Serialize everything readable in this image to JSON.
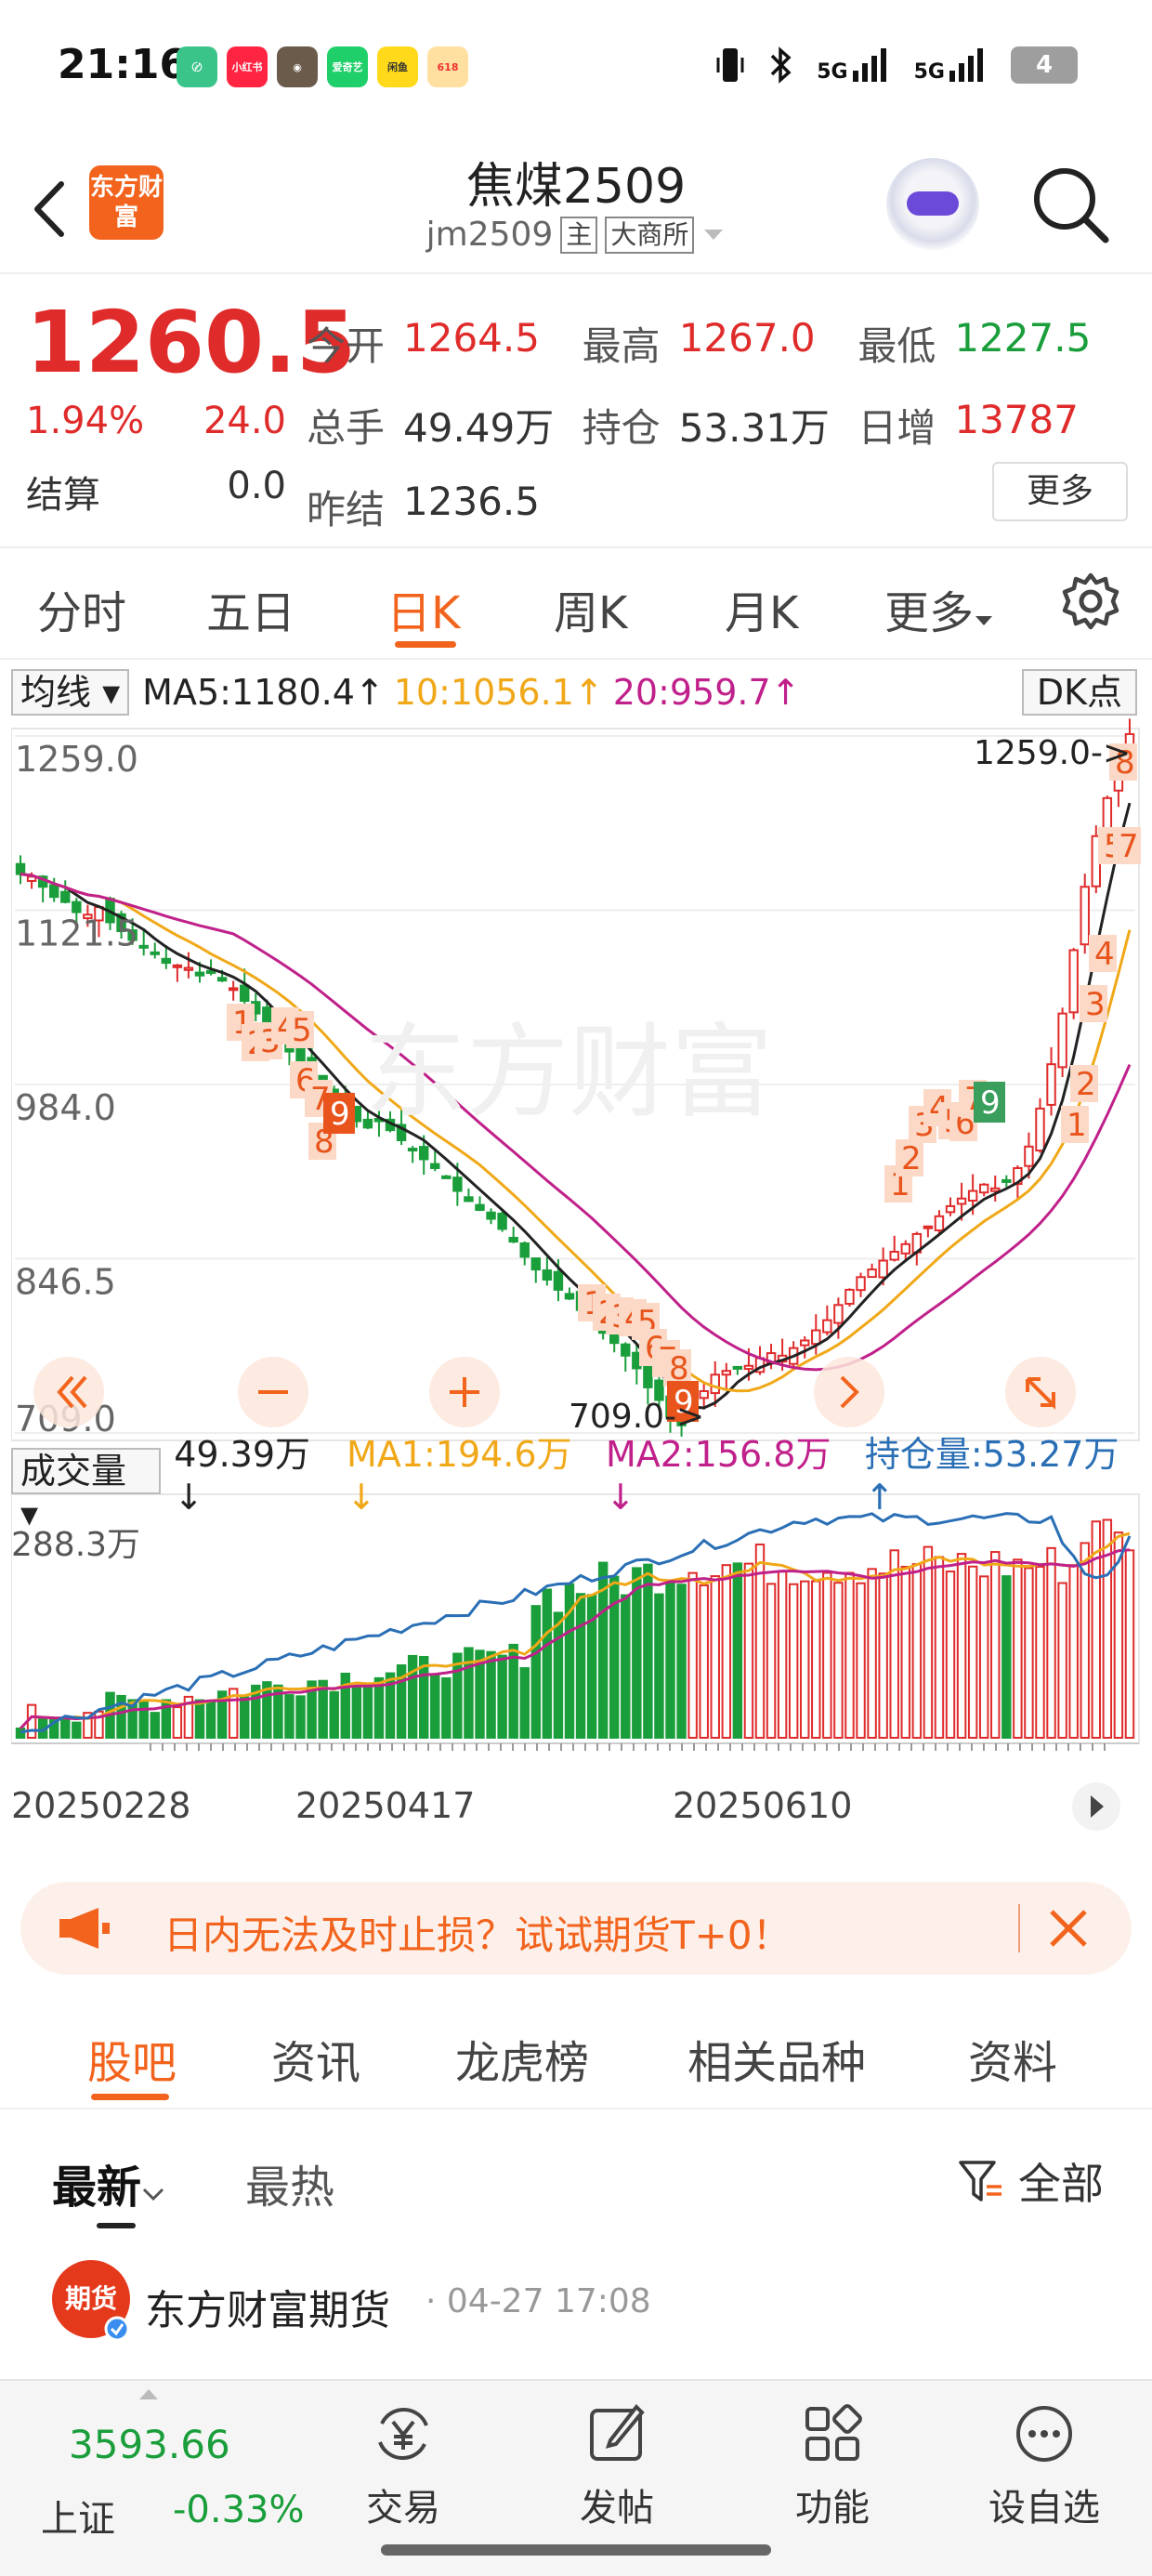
{
  "status_bar": {
    "time": "21:16",
    "apps": [
      "小红书",
      "爱奇艺",
      "闲鱼",
      "618"
    ],
    "signal_1": "5G",
    "signal_2": "5G",
    "battery": "4"
  },
  "header": {
    "logo_text": "东方财富",
    "title": "焦煤2509",
    "code": "jm2509",
    "tag_main": "主",
    "tag_exchange": "大商所"
  },
  "quote": {
    "price": "1260.5",
    "change_pct": "1.94%",
    "change": "24.0",
    "settle_label": "结算",
    "settle_value": "0.0",
    "open_label": "今开",
    "open_value": "1264.5",
    "high_label": "最高",
    "high_value": "1267.0",
    "low_label": "最低",
    "low_value": "1227.5",
    "volume_label": "总手",
    "volume_value": "49.49万",
    "oi_label": "持仓",
    "oi_value": "53.31万",
    "oi_inc_label": "日增",
    "oi_inc_value": "13787",
    "prev_settle_label": "昨结",
    "prev_settle_value": "1236.5",
    "more_button": "更多"
  },
  "period_tabs": [
    "分时",
    "五日",
    "日K",
    "周K",
    "月K",
    "更多"
  ],
  "chart": {
    "ma_selector": "均线",
    "ma5": "MA5:1180.4↑",
    "ma10": "10:1056.1↑",
    "ma20": "20:959.7↑",
    "dk_button": "DK点",
    "y_labels": [
      "1259.0",
      "1121.5",
      "984.0",
      "846.5",
      "709.0"
    ],
    "max_marker": "1259.0->",
    "min_marker": "709.0->",
    "vol_selector": "成交量",
    "vol_value": "49.39万↓",
    "vol_ma1": "MA1:194.6万↓",
    "vol_ma2": "MA2:156.8万↓",
    "vol_oi": "持仓量:53.27万↑",
    "vol_max_label": "288.3万",
    "dates": [
      "20250228",
      "20250417",
      "20250610"
    ],
    "colors": {
      "up": "#e02b2b",
      "down": "#1a9e3b",
      "ma5": "#222222",
      "ma10": "#f0a818",
      "ma20": "#c0208a",
      "oi": "#2a6fb5"
    }
  },
  "chart_data": {
    "type": "candlestick",
    "title": "焦煤2509",
    "ylim": [
      709.0,
      1259.0
    ],
    "series": [
      {
        "name": "MA5",
        "value": 1180.4
      },
      {
        "name": "MA10",
        "value": 1056.1
      },
      {
        "name": "MA20",
        "value": 959.7
      }
    ],
    "close_path": [
      1150,
      1148,
      1140,
      1132,
      1128,
      1120,
      1118,
      1124,
      1112,
      1105,
      1098,
      1092,
      1088,
      1080,
      1078,
      1076,
      1070,
      1072,
      1066,
      1060,
      1050,
      1040,
      1030,
      1020,
      1010,
      1000,
      990,
      982,
      970,
      960,
      955,
      950,
      955,
      948,
      940,
      932,
      925,
      918,
      910,
      900,
      892,
      885,
      878,
      870,
      860,
      848,
      838,
      830,
      822,
      815,
      806,
      798,
      788,
      780,
      770,
      760,
      745,
      735,
      722,
      715,
      730,
      742,
      755,
      758,
      760,
      762,
      768,
      772,
      770,
      776,
      782,
      790,
      798,
      810,
      822,
      832,
      838,
      845,
      852,
      858,
      866,
      872,
      880,
      888,
      894,
      900,
      905,
      902,
      908,
      918,
      935,
      965,
      1000,
      1040,
      1090,
      1140,
      1180,
      1210,
      1240,
      1260.5
    ],
    "volume_max": 2883000,
    "x_ticks": [
      "20250228",
      "20250417",
      "20250610"
    ]
  },
  "promo": {
    "text": "日内无法及时止损？试试期货T+0！"
  },
  "section_tabs": [
    "股吧",
    "资讯",
    "龙虎榜",
    "相关品种",
    "资料"
  ],
  "sort": {
    "latest": "最新",
    "hot": "最热",
    "filter": "全部"
  },
  "post": {
    "avatar_text": "期货",
    "author": "东方财富期货",
    "time": "· 04-27 17:08"
  },
  "bottom": {
    "index_value": "3593.66",
    "index_name": "上证",
    "index_change": "-0.33%",
    "nav": [
      "交易",
      "发帖",
      "功能",
      "设自选"
    ]
  }
}
